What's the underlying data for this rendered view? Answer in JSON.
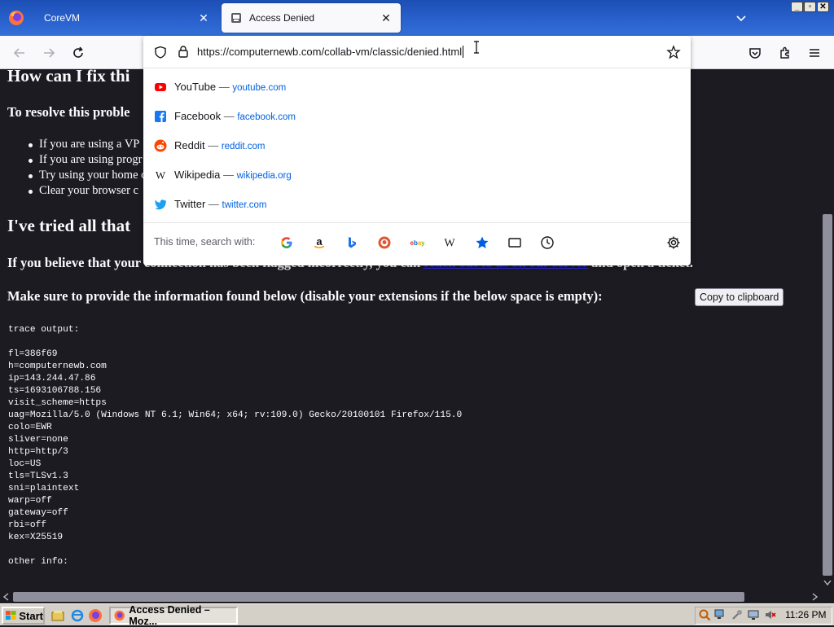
{
  "window": {
    "tabs": [
      {
        "label": "CoreVM",
        "active": false
      },
      {
        "label": "Access Denied",
        "active": true
      }
    ]
  },
  "urlbar": {
    "value": "https://computernewb.com/collab-vm/classic/denied.html",
    "suggestions": [
      {
        "name": "YouTube",
        "separator": "—",
        "domain": "youtube.com",
        "icon": "youtube-icon",
        "color": "#ff0000"
      },
      {
        "name": "Facebook",
        "separator": "—",
        "domain": "facebook.com",
        "icon": "facebook-icon",
        "color": "#1877f2"
      },
      {
        "name": "Reddit",
        "separator": "—",
        "domain": "reddit.com",
        "icon": "reddit-icon",
        "color": "#ff4500"
      },
      {
        "name": "Wikipedia",
        "separator": "—",
        "domain": "wikipedia.org",
        "icon": "wikipedia-icon",
        "color": "#15141a"
      },
      {
        "name": "Twitter",
        "separator": "—",
        "domain": "twitter.com",
        "icon": "twitter-icon",
        "color": "#1da1f2"
      }
    ],
    "search_with_label": "This time, search with:",
    "engines": [
      "google-icon",
      "amazon-icon",
      "bing-icon",
      "duckduckgo-icon",
      "ebay-icon",
      "wikipedia-icon",
      "bookmarks-icon",
      "tabs-icon",
      "history-icon"
    ]
  },
  "content": {
    "heading1": "How can I fix thi",
    "resolve": "To resolve this proble",
    "bullets": [
      "If you are using a VP",
      "If you are using progr",
      "Try using your home c",
      "Clear your browser c"
    ],
    "heading2": "I've tried all that",
    "believe_pre": "If you believe that your connection has been flagged incorrectly, you can",
    "believe_link": "reach out to us on our server",
    "believe_post": "and open a ticket.",
    "provide": "Make sure to provide the information found below (disable your extensions if the below space is empty):",
    "copy_button": "Copy to clipboard",
    "trace": "trace output:\n\nfl=386f69\nh=computernewb.com\nip=143.244.47.86\nts=1693106788.156\nvisit_scheme=https\nuag=Mozilla/5.0 (Windows NT 6.1; Win64; x64; rv:109.0) Gecko/20100101 Firefox/115.0\ncolo=EWR\nsliver=none\nhttp=http/3\nloc=US\ntls=TLSv1.3\nsni=plaintext\nwarp=off\ngateway=off\nrbi=off\nkex=X25519\n\nother info:"
  },
  "taskbar": {
    "start_label": "Start",
    "task_label": "Access Denied – Moz...",
    "clock": "11:26 PM"
  },
  "colors": {
    "page_background": "#1c1b22",
    "page_text": "#fbfbfe",
    "titlebar": "#2a62cf",
    "accent": "#0061e0"
  }
}
